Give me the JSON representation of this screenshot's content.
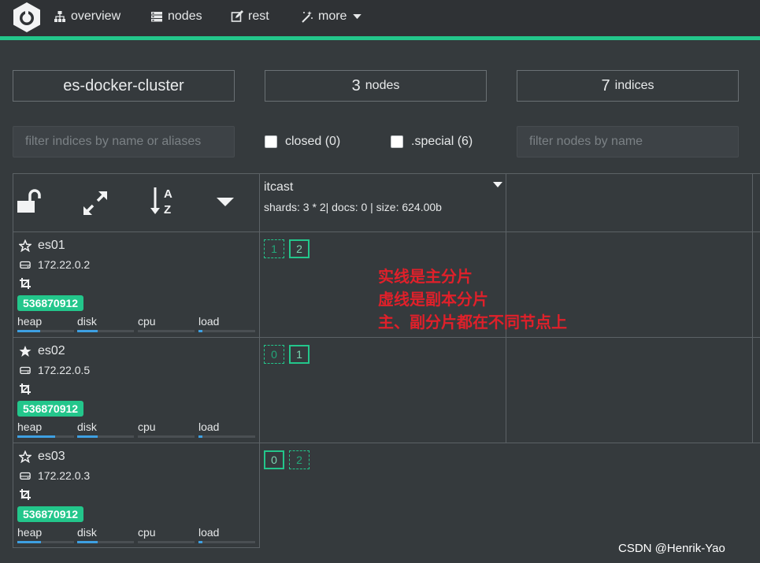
{
  "nav": {
    "items": [
      {
        "label": "overview",
        "icon": "sitemap-icon"
      },
      {
        "label": "nodes",
        "icon": "server-icon"
      },
      {
        "label": "rest",
        "icon": "edit-icon"
      },
      {
        "label": "more",
        "icon": "magic-wand-icon"
      }
    ]
  },
  "stats": {
    "cluster_name": "es-docker-cluster",
    "nodes_count": "3",
    "nodes_label": "nodes",
    "indices_count": "7",
    "indices_label": "indices"
  },
  "filters": {
    "indices_placeholder": "filter indices by name or aliases",
    "closed_label": "closed (0)",
    "special_label": ".special (6)",
    "nodes_placeholder": "filter nodes by name"
  },
  "index": {
    "name": "itcast",
    "meta": "shards: 3 * 2| docs: 0 | size: 624.00b"
  },
  "metrics_labels": [
    "heap",
    "disk",
    "cpu",
    "load"
  ],
  "nodes": [
    {
      "name": "es01",
      "master": false,
      "ip": "172.22.0.2",
      "badge": "536870912",
      "heap": 0.4,
      "disk": 0.36,
      "cpu": 0.0,
      "load": 0.07,
      "shards": [
        {
          "n": "1",
          "type": "replica"
        },
        {
          "n": "2",
          "type": "primary"
        }
      ]
    },
    {
      "name": "es02",
      "master": true,
      "ip": "172.22.0.5",
      "badge": "536870912",
      "heap": 0.67,
      "disk": 0.36,
      "cpu": 0.0,
      "load": 0.07,
      "shards": [
        {
          "n": "0",
          "type": "replica"
        },
        {
          "n": "1",
          "type": "primary"
        }
      ]
    },
    {
      "name": "es03",
      "master": false,
      "ip": "172.22.0.3",
      "badge": "536870912",
      "heap": 0.42,
      "disk": 0.36,
      "cpu": 0.0,
      "load": 0.07,
      "shards": [
        {
          "n": "0",
          "type": "primary"
        },
        {
          "n": "2",
          "type": "replica"
        }
      ]
    }
  ],
  "annotation": {
    "line1": "实线是主分片",
    "line2": "虚线是副本分片",
    "line3": "主、副分片都在不同节点上"
  },
  "watermark": "CSDN @Henrik-Yao",
  "colors": {
    "accent": "#23c68b",
    "bar_fill": "#3ea0e2",
    "annotation": "#e0202a"
  }
}
